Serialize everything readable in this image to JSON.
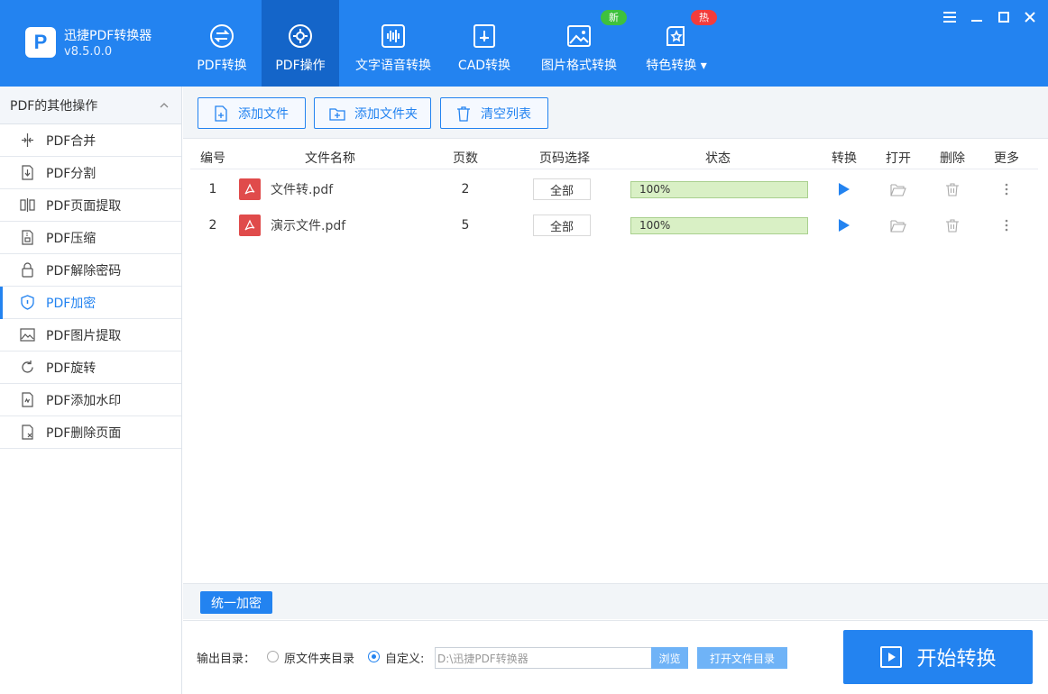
{
  "app": {
    "name": "迅捷PDF转换器",
    "version": "v8.5.0.0",
    "logo_letter": "P"
  },
  "nav": {
    "tabs": [
      {
        "label": "PDF转换",
        "icon": "convert-icon"
      },
      {
        "label": "PDF操作",
        "icon": "gear-icon",
        "active": true
      },
      {
        "label": "文字语音转换",
        "icon": "waveform-icon"
      },
      {
        "label": "CAD转换",
        "icon": "cad-icon"
      },
      {
        "label": "图片格式转换",
        "icon": "image-icon",
        "badge": "新"
      },
      {
        "label": "特色转换",
        "icon": "star-icon",
        "badge": "热"
      }
    ]
  },
  "window_controls": [
    "menu-icon",
    "minimize-icon",
    "maximize-icon",
    "close-icon"
  ],
  "sidebar": {
    "header": "PDF的其他操作",
    "items": [
      {
        "label": "PDF合并"
      },
      {
        "label": "PDF分割"
      },
      {
        "label": "PDF页面提取"
      },
      {
        "label": "PDF压缩"
      },
      {
        "label": "PDF解除密码"
      },
      {
        "label": "PDF加密",
        "active": true
      },
      {
        "label": "PDF图片提取"
      },
      {
        "label": "PDF旋转"
      },
      {
        "label": "PDF添加水印"
      },
      {
        "label": "PDF删除页面"
      }
    ]
  },
  "toolbar": {
    "add_file": "添加文件",
    "add_folder": "添加文件夹",
    "clear_list": "清空列表"
  },
  "table": {
    "headers": {
      "num": "编号",
      "name": "文件名称",
      "pages": "页数",
      "page_select": "页码选择",
      "status": "状态",
      "convert": "转换",
      "open": "打开",
      "delete": "删除",
      "more": "更多"
    },
    "rows": [
      {
        "num": "1",
        "name": "文件转.pdf",
        "pages": "2",
        "page_select": "全部",
        "progress": "100%"
      },
      {
        "num": "2",
        "name": "演示文件.pdf",
        "pages": "5",
        "page_select": "全部",
        "progress": "100%"
      }
    ]
  },
  "bottom": {
    "encrypt_all": "统一加密"
  },
  "footer": {
    "output_label": "输出目录：",
    "option_original": "原文件夹目录",
    "option_custom": "自定义:",
    "path": "D:\\迅捷PDF转换器",
    "browse": "浏览",
    "open_dir": "打开文件目录",
    "start": "开始转换"
  },
  "colors": {
    "primary": "#2383f0",
    "active_tab": "#1465c9",
    "progress_fill": "#d9f0c5",
    "pdf_red": "#e04b4b"
  }
}
